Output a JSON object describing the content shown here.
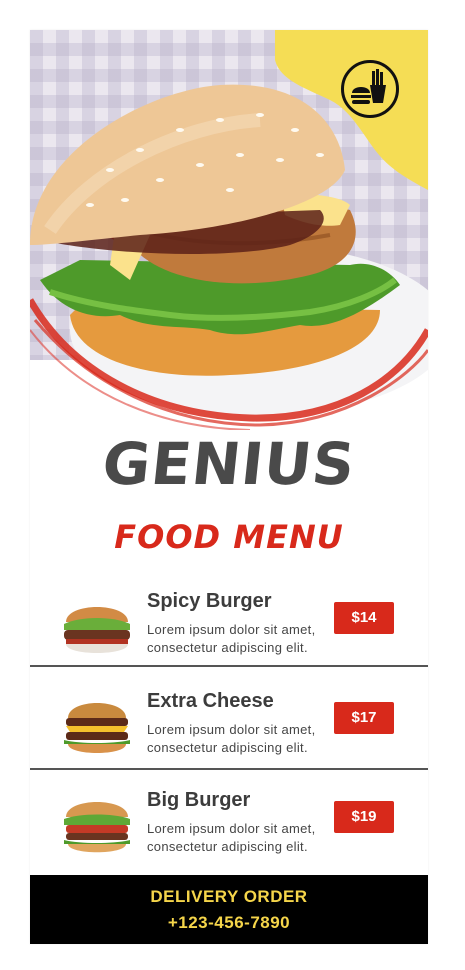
{
  "brand": {
    "title": "GENIUS",
    "subtitle": "FOOD MENU"
  },
  "menu": [
    {
      "name": "Spicy Burger",
      "desc_line1": "Lorem ipsum dolor sit amet,",
      "desc_line2": "consectetur adipiscing elit.",
      "price": "$14"
    },
    {
      "name": "Extra Cheese",
      "desc_line1": "Lorem ipsum dolor sit amet,",
      "desc_line2": "consectetur adipiscing elit.",
      "price": "$17"
    },
    {
      "name": "Big Burger",
      "desc_line1": "Lorem ipsum dolor sit amet,",
      "desc_line2": "consectetur adipiscing elit.",
      "price": "$19"
    }
  ],
  "footer": {
    "line1": "DELIVERY ORDER",
    "line2": "+123-456-7890"
  },
  "colors": {
    "accent_red": "#d8291b",
    "accent_yellow": "#f5dd55",
    "footer_bg": "#000000"
  },
  "icons": [
    "burger-fries-logo-icon",
    "burger-photo",
    "burger-thumbnail"
  ]
}
